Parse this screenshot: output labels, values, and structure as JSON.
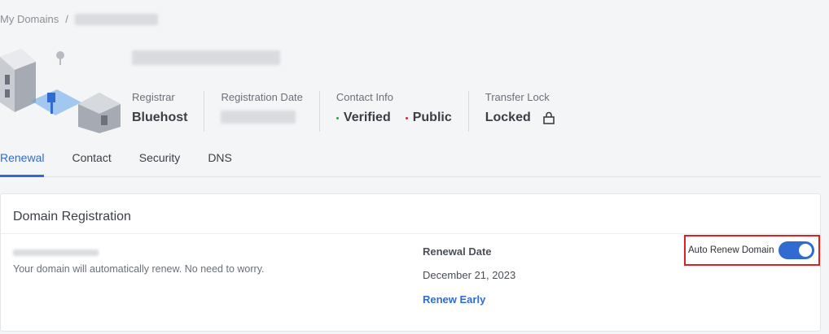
{
  "breadcrumb": {
    "root": "My Domains",
    "separator": "/"
  },
  "info": {
    "registrar_label": "Registrar",
    "registrar_value": "Bluehost",
    "registration_date_label": "Registration Date",
    "contact_label": "Contact Info",
    "contact_verified": "Verified",
    "contact_public": "Public",
    "transfer_label": "Transfer Lock",
    "transfer_value": "Locked"
  },
  "tabs": [
    {
      "label": "Renewal",
      "active": true
    },
    {
      "label": "Contact",
      "active": false
    },
    {
      "label": "Security",
      "active": false
    },
    {
      "label": "DNS",
      "active": false
    }
  ],
  "card": {
    "title": "Domain Registration",
    "status_text": "Your domain will automatically renew. No need to worry.",
    "renewal_date_label": "Renewal Date",
    "renewal_date_value": "December 21, 2023",
    "renew_early_label": "Renew Early",
    "auto_renew_label": "Auto Renew Domain",
    "auto_renew_on": true
  },
  "colors": {
    "accent": "#2f6bd0",
    "verified_dot": "#2e9e4f",
    "public_dot": "#d0263a",
    "highlight_border": "#e02020"
  },
  "icons": [
    "lock-icon",
    "house-illustration"
  ]
}
